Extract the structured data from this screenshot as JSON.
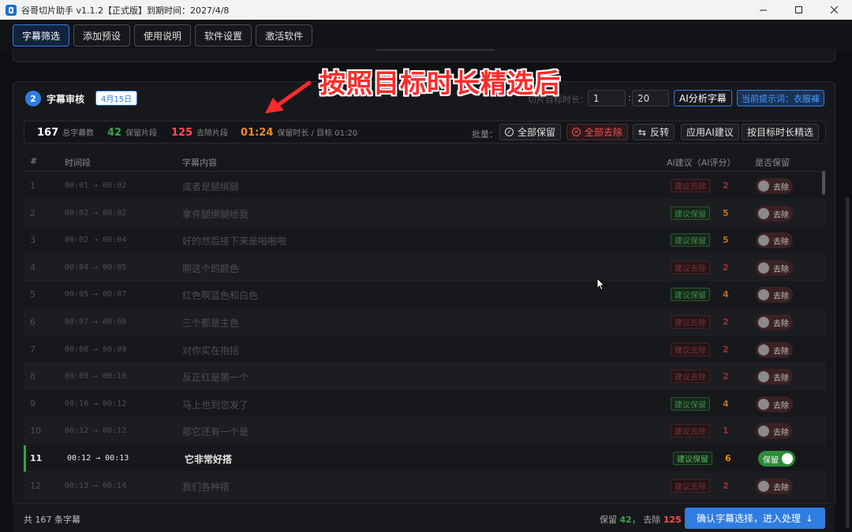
{
  "window": {
    "title": "谷哥切片助手 v1.1.2【正式版】到期时间：2027/4/8"
  },
  "toolbar": {
    "tabs": [
      {
        "label": "字幕筛选",
        "active": true
      },
      {
        "label": "添加预设",
        "active": false
      },
      {
        "label": "使用说明",
        "active": false
      },
      {
        "label": "软件设置",
        "active": false
      },
      {
        "label": "激活软件",
        "active": false
      }
    ]
  },
  "annotation": {
    "text": "按照目标时长精选后"
  },
  "section": {
    "step": "2",
    "title": "字幕审核",
    "date_badge": "4月15日",
    "clip_length_label": "切片目标时长：",
    "clip_length_value1": "1",
    "clip_length_value2": "20",
    "ai_analyze_label": "AI分析字幕",
    "prompt_label": "当前提示词：衣服褲"
  },
  "stats": {
    "total_value": "167",
    "total_label": "总字幕数",
    "keep_value": "42",
    "keep_label": "保留片段",
    "remove_value": "125",
    "remove_label": "去除片段",
    "duration_value": "01:24",
    "duration_label": "保留时长 / 目标 01:20",
    "batch_label": "批量：",
    "keep_all": "全部保留",
    "remove_all": "全部去除",
    "invert": "反转",
    "apply_ai": "应用AI建议",
    "select_by_target": "按目标时长精选"
  },
  "table": {
    "headers": {
      "idx": "#",
      "time": "时间段",
      "text": "字幕内容",
      "ai": "AI建议（AI评分）",
      "keep": "是否保留"
    },
    "rows": [
      {
        "idx": "1",
        "time": "00:01 → 00:02",
        "text": "或者是腿绑腿",
        "suggestion": "建议去除",
        "sugg_type": "remove",
        "score": "2",
        "toggle": "去除",
        "on": false
      },
      {
        "idx": "2",
        "time": "00:02 → 00:02",
        "text": "拿件腿绑腿给我",
        "suggestion": "建议保留",
        "sugg_type": "keep",
        "score": "5",
        "toggle": "去除",
        "on": false
      },
      {
        "idx": "3",
        "time": "00:02 → 00:04",
        "text": "好的然后接下来是啪啪啪",
        "suggestion": "建议保留",
        "sugg_type": "keep",
        "score": "5",
        "toggle": "去除",
        "on": false
      },
      {
        "idx": "4",
        "time": "00:04 → 00:05",
        "text": "啊这个的颜色",
        "suggestion": "建议去除",
        "sugg_type": "remove",
        "score": "2",
        "toggle": "去除",
        "on": false
      },
      {
        "idx": "5",
        "time": "00:05 → 00:07",
        "text": "红色啊蓝色和白色",
        "suggestion": "建议保留",
        "sugg_type": "keep",
        "score": "4",
        "toggle": "去除",
        "on": false
      },
      {
        "idx": "6",
        "time": "00:07 → 00:08",
        "text": "三个都是主色",
        "suggestion": "建议去除",
        "sugg_type": "remove",
        "score": "2",
        "toggle": "去除",
        "on": false
      },
      {
        "idx": "7",
        "time": "00:08 → 00:09",
        "text": "对你实在抱括",
        "suggestion": "建议去除",
        "sugg_type": "remove",
        "score": "2",
        "toggle": "去除",
        "on": false
      },
      {
        "idx": "8",
        "time": "00:09 → 00:10",
        "text": "反正红是第一个",
        "suggestion": "建议去除",
        "sugg_type": "remove",
        "score": "2",
        "toggle": "去除",
        "on": false
      },
      {
        "idx": "9",
        "time": "00:10 → 00:12",
        "text": "马上也到您发了",
        "suggestion": "建议保留",
        "sugg_type": "keep",
        "score": "4",
        "toggle": "去除",
        "on": false
      },
      {
        "idx": "10",
        "time": "00:12 → 00:12",
        "text": "那它还有一个是",
        "suggestion": "建议去除",
        "sugg_type": "remove",
        "score": "1",
        "toggle": "去除",
        "on": false
      },
      {
        "idx": "11",
        "time": "00:12 → 00:13",
        "text": "它非常好搭",
        "suggestion": "建议保留",
        "sugg_type": "keep",
        "score": "6",
        "toggle": "保留",
        "on": true
      },
      {
        "idx": "12",
        "time": "00:13 → 00:14",
        "text": "我们各种搭",
        "suggestion": "建议去除",
        "sugg_type": "remove",
        "score": "2",
        "toggle": "去除",
        "on": false
      }
    ]
  },
  "footer": {
    "total_text": "共 167 条字幕",
    "keep_label": "保留",
    "keep_value": "42",
    "sep": "，",
    "remove_label": "去除",
    "remove_value": "125",
    "confirm_label": "确认字幕选择，进入处理"
  },
  "colors": {
    "accent": "#2f7de0",
    "keep_green": "#3aa14a",
    "remove_red": "#ff4d4f",
    "duration_orange": "#f08a24",
    "annotation_red": "#ff2a2a"
  }
}
